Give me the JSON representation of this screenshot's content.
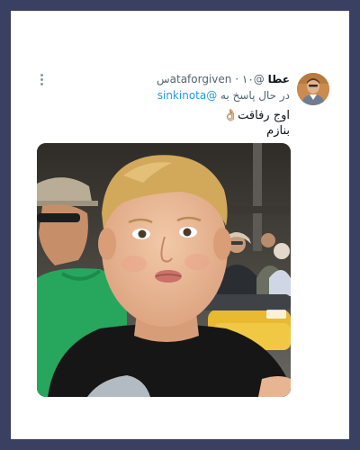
{
  "tweet": {
    "display_name": "عطا",
    "handle": "@ataforgiven",
    "timestamp": "۱۰س",
    "reply_prefix": "در حال پاسخ به",
    "reply_to": "@sinkinota",
    "text_line1": "اوج رفاقت👌🏼",
    "text_line2": "بنازم"
  },
  "icons": {
    "more": "more-dots-icon",
    "reaction": "ok-hand-emoji"
  },
  "colors": {
    "frame": "#3a4062",
    "card": "#ffffff",
    "link": "#1d9bf0",
    "secondary_text": "#536471",
    "primary_text": "#0f1419"
  }
}
